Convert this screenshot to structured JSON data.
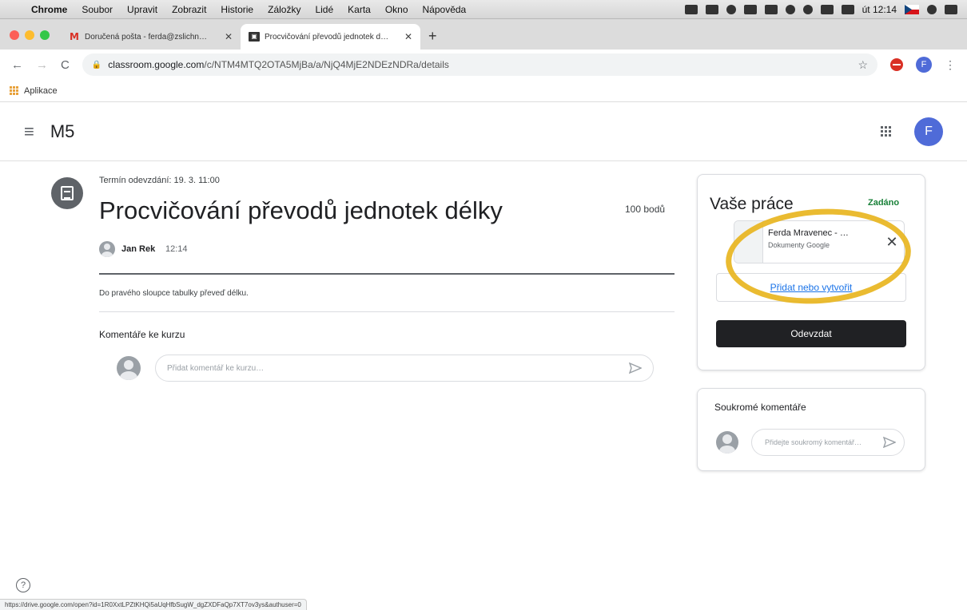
{
  "menubar": {
    "apple": "",
    "items": [
      "Chrome",
      "Soubor",
      "Upravit",
      "Zobrazit",
      "Historie",
      "Záložky",
      "Lidé",
      "Karta",
      "Okno",
      "Nápověda"
    ],
    "clock": "út 12:14"
  },
  "tabs": [
    {
      "favicon": "M",
      "title": "Doručená pošta - ferda@zslichn…"
    },
    {
      "favicon": "▣",
      "title": "Procvičování převodů jednotek d…"
    }
  ],
  "tab_close": "✕",
  "new_tab": "+",
  "addressbar": {
    "back": "←",
    "forward": "→",
    "reload": "C",
    "lock": "🔒",
    "url_host": "classroom.google.com",
    "url_path": "/c/NTM4MTQ2OTA5MjBa/a/NjQ4MjE2NDEzNDRa/details",
    "star": "☆",
    "avatar_letter": "F",
    "menu": "⋮"
  },
  "bookmarks": {
    "apps_label": "Aplikace"
  },
  "header": {
    "menu_icon": "≡",
    "class_name": "M5",
    "avatar_letter": "F"
  },
  "assignment": {
    "due": "Termín odevzdání: 19. 3. 11:00",
    "title": "Procvičování převodů jednotek délky",
    "points": "100 bodů",
    "author": "Jan Rek",
    "time": "12:14",
    "instructions": "Do pravého sloupce tabulky převeď délku.",
    "class_comments_title": "Komentáře ke kurzu",
    "comment_placeholder": "Přidat komentář ke kurzu…"
  },
  "your_work": {
    "title": "Vaše práce",
    "status": "Zadáno",
    "file_name": "Ferda Mravenec - …",
    "file_type": "Dokumenty Google",
    "remove": "✕",
    "add_create": "Přidat nebo vytvořit",
    "submit": "Odevzdat"
  },
  "private_comments": {
    "title": "Soukromé komentáře",
    "placeholder": "Přidejte soukromý komentář…"
  },
  "help": "?",
  "status_url": "https://drive.google.com/open?id=1R0XxtLPZtKHQi5aUqHfbSugW_dgZXDFaQp7XT7ov3ys&authuser=0",
  "colors": {
    "highlight_ring": "#e8b520",
    "submit_bg": "#202124",
    "status_green": "#188038",
    "avatar_blue": "#4f6bd8"
  }
}
